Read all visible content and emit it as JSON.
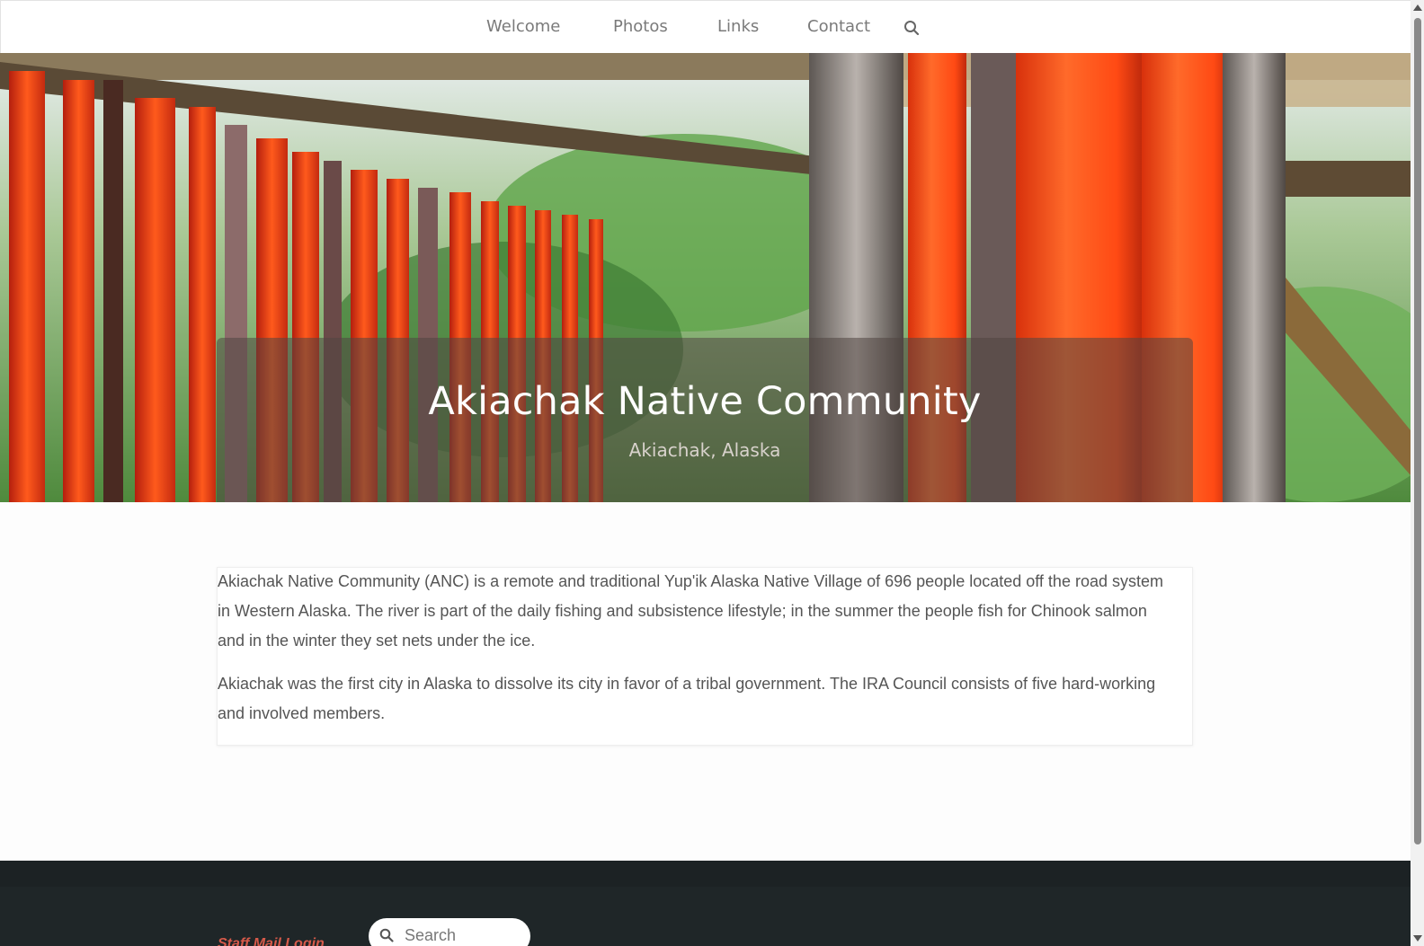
{
  "nav": {
    "items": [
      {
        "label": "Welcome"
      },
      {
        "label": "Photos"
      },
      {
        "label": "Links"
      },
      {
        "label": "Contact"
      }
    ],
    "search_icon": "search-icon"
  },
  "hero": {
    "title": "Akiachak Native Community",
    "subtitle": "Akiachak, Alaska",
    "image_description_icon": "drying-salmon-photo"
  },
  "content": {
    "paragraphs": [
      "Akiachak Native Community (ANC) is a remote and traditional Yup'ik Alaska Native Village of 696 people located off the road system in Western Alaska. The river is part of the daily fishing and subsistence lifestyle; in the summer the people fish for Chinook salmon and in the winter they set nets under the ice.",
      "Akiachak was the first city in Alaska to dissolve its city in favor of a tribal government. The IRA Council consists of five hard-working and involved members."
    ]
  },
  "footer": {
    "link_label": "Staff Mail Login",
    "search_placeholder": "Search",
    "search_value": ""
  },
  "colors": {
    "nav_text": "#7a7a7a",
    "body_text": "#555555",
    "footer_bg": "#1f2628",
    "footer_link": "#d65a4a"
  }
}
